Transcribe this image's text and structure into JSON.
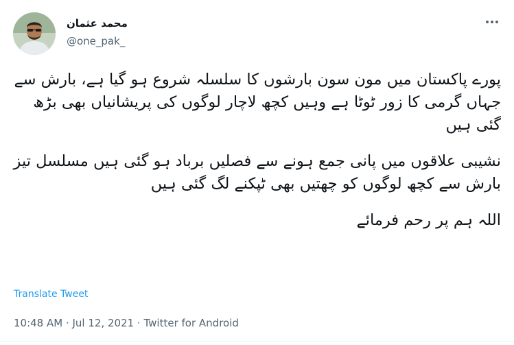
{
  "tweet": {
    "author_name": "محمد عثمان",
    "author_handle": "@one_pak_",
    "paragraphs": [
      "پورے پاکستان میں مون سون بارشوں کا سلسلہ شروع ہو گیا ہے، بارش سے جہاں گرمی کا زور ٹوٹا ہے وہیں کچھ لاچار لوگوں کی پریشانیاں بھی بڑھ گئی ہیں",
      "نشیبی علاقوں میں پانی جمع ہونے سے فصلیں برباد ہو گئی ہیں مسلسل تیز بارش سے کچھ لوگوں کو چھتیں بھی ٹپکنے لگ گئی ہیں",
      "اللہ ہم پر رحم فرمائے"
    ],
    "translate_label": "Translate Tweet",
    "meta": "10:48 AM · Jul 12, 2021 · Twitter for Android"
  },
  "icons": {
    "more": "more-horizontal-icon"
  },
  "colors": {
    "link": "#1d9bf0",
    "secondary": "#536471",
    "text": "#0f1419"
  }
}
